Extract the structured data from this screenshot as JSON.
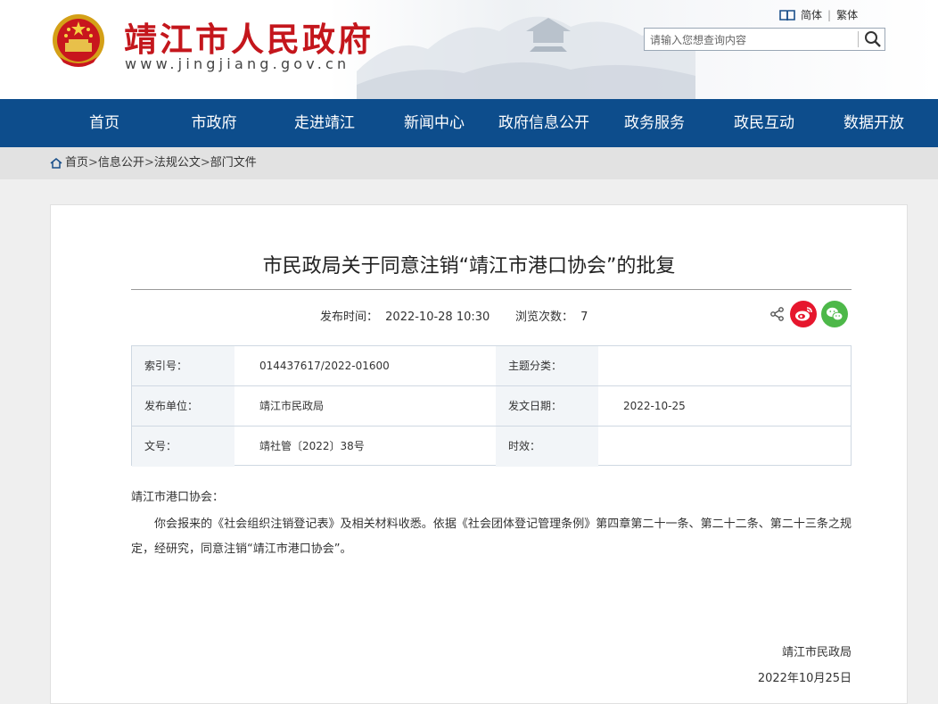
{
  "header": {
    "site_title": "靖江市人民政府",
    "site_domain": "www.jingjiang.gov.cn",
    "lang_simplified": "简体",
    "lang_separator": "|",
    "lang_traditional": "繁体",
    "search_placeholder": "请输入您想查询内容"
  },
  "nav": {
    "items": [
      "首页",
      "市政府",
      "走进靖江",
      "新闻中心",
      "政府信息公开",
      "政务服务",
      "政民互动",
      "数据开放"
    ]
  },
  "breadcrumb": {
    "items": [
      "首页",
      "信息公开",
      "法规公文",
      "部门文件"
    ],
    "separator": ">"
  },
  "article": {
    "title": "市民政局关于同意注销“靖江市港口协会”的批复",
    "publish_label": "发布时间：",
    "publish_time": "2022-10-28 10:30",
    "views_label": "浏览次数：",
    "views": "7",
    "info": {
      "index_label": "索引号：",
      "index_value": "014437617/2022-01600",
      "topic_label": "主题分类：",
      "topic_value": "",
      "issuer_label": "发布单位：",
      "issuer_value": "靖江市民政局",
      "date_label": "发文日期：",
      "date_value": "2022-10-25",
      "docno_label": "文号：",
      "docno_value": "靖社管〔2022〕38号",
      "validity_label": "时效：",
      "validity_value": ""
    },
    "greeting": "靖江市港口协会：",
    "paragraph": "你会报来的《社会组织注销登记表》及相关材料收悉。依据《社会团体登记管理条例》第四章第二十一条、第二十二条、第二十三条之规定，经研究，同意注销“靖江市港口协会”。",
    "signature_org": "靖江市民政局",
    "signature_date": "2022年10月25日"
  },
  "colors": {
    "nav_bg": "#0d4d8c",
    "title_red": "#c4161c",
    "weibo": "#e6162d",
    "wechat": "#4db849"
  }
}
